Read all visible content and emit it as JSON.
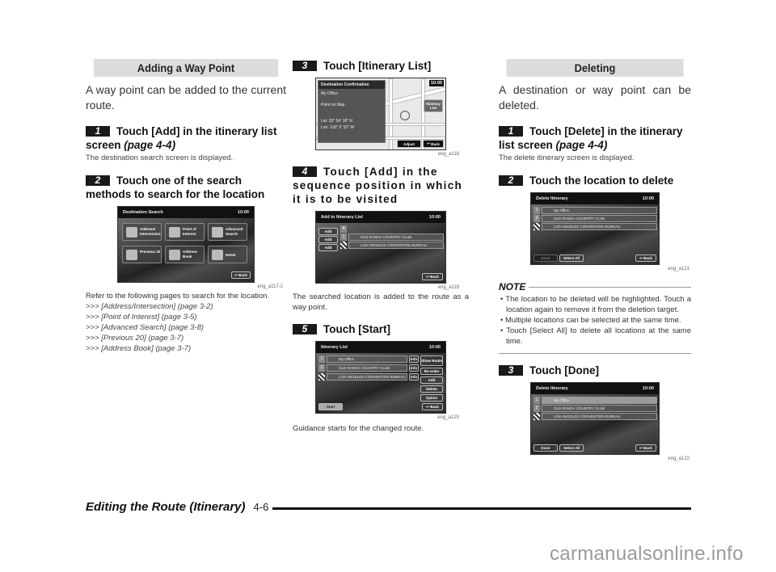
{
  "section1": {
    "heading": "Adding a Way Point",
    "intro": "A way point can be added to the current route.",
    "steps": [
      {
        "num": "1",
        "text": "Touch [Add] in the itinerary list screen ",
        "page": "(page 4-4)",
        "sub": "The destination search screen is displayed."
      },
      {
        "num": "2",
        "text": "Touch one of the search methods to search for the location"
      }
    ],
    "screen_dest_search": {
      "title": "Destination Search",
      "time": "10:00",
      "tiles": [
        "Address/ Intersection",
        "Point of Interest",
        "Advanced Search",
        "Previous 20",
        "Address Book",
        "Home"
      ],
      "back": "Back",
      "caption": "eng_a117-2"
    },
    "refer_text": "Refer to the following pages to search for the location.",
    "refs": [
      ">>> [Address/Intersection] (page 3-2)",
      ">>> [Point of Interest] (page 3-5)",
      ">>> [Advanced Search] (page 3-8)",
      ">>> [Previous 20] (page 3-7)",
      ">>> [Address Book] (page 3-7)"
    ]
  },
  "section2": {
    "step3": {
      "num": "3",
      "text": "Touch [Itinerary List]"
    },
    "screen_confirm": {
      "title": "Destination Confirmation",
      "time": "10:00",
      "name": "My Office",
      "point": "Point on Map",
      "lat": "Lat:  33° 54' 18\" N",
      "lon": "Lon: 118°  5' 53\" W",
      "itinerary_btn": "Itinerary List",
      "adjust": "Adjust",
      "back": "Back",
      "caption": "eng_a118"
    },
    "step4": {
      "num": "4",
      "text": "Touch [Add] in the sequence position in which it is to be visited"
    },
    "screen_add": {
      "title": "Add to Itinerary List",
      "time": "10:00",
      "add": "Add",
      "rows": [
        "OLD RANCH COUNTRY CLUB",
        "LOS ANGELES CONVENTION BUREAU"
      ],
      "back": "Back",
      "caption": "eng_a119"
    },
    "after4": "The searched location is added to the route as a way point.",
    "step5": {
      "num": "5",
      "text": "Touch [Start]"
    },
    "screen_itin": {
      "title": "Itinerary List",
      "time": "10:00",
      "rows": [
        "My Office",
        "OLD RANCH COUNTRY CLUB",
        "LOS ANGELES CONVENTION BUREAU"
      ],
      "info": "Info",
      "side": [
        "Show Route",
        "Re-order",
        "Add",
        "Delete",
        "Option"
      ],
      "start": "Start",
      "back": "Back",
      "caption": "eng_a120"
    },
    "after5": "Guidance starts for the changed route."
  },
  "section3": {
    "heading": "Deleting",
    "intro": "A destination or way point can be deleted.",
    "step1": {
      "num": "1",
      "text": "Touch [Delete] in the itinerary list screen ",
      "page": "(page 4-4)",
      "sub": "The delete itinerary screen is displayed."
    },
    "step2": {
      "num": "2",
      "text": "Touch the location to delete"
    },
    "screen_del1": {
      "title": "Delete Itinerary",
      "time": "10:00",
      "rows": [
        "My Office",
        "OLD RANCH COUNTRY CLUB",
        "LOS ANGELES CONVENTION BUREAU"
      ],
      "done": "Done",
      "select_all": "Select All",
      "back": "Back",
      "caption": "eng_a121"
    },
    "note": {
      "label": "NOTE",
      "items": [
        "The location to be deleted will be highlighted. Touch a location again to remove it from the deletion target.",
        "Multiple locations can be selected at the same time.",
        "Touch [Select All] to delete all locations at the same time."
      ]
    },
    "step3": {
      "num": "3",
      "text": "Touch [Done]"
    },
    "screen_del2": {
      "title": "Delete Itinerary",
      "time": "10:00",
      "rows": [
        "My Office",
        "OLD RANCH COUNTRY CLUB",
        "LOS ANGELES CONVENTION BUREAU"
      ],
      "done": "Done",
      "select_all": "Select All",
      "back": "Back",
      "caption": "eng_a122"
    }
  },
  "footer": {
    "title": "Editing the Route (Itinerary)",
    "page": "4-6"
  },
  "watermark": "carmanualsonline.info"
}
